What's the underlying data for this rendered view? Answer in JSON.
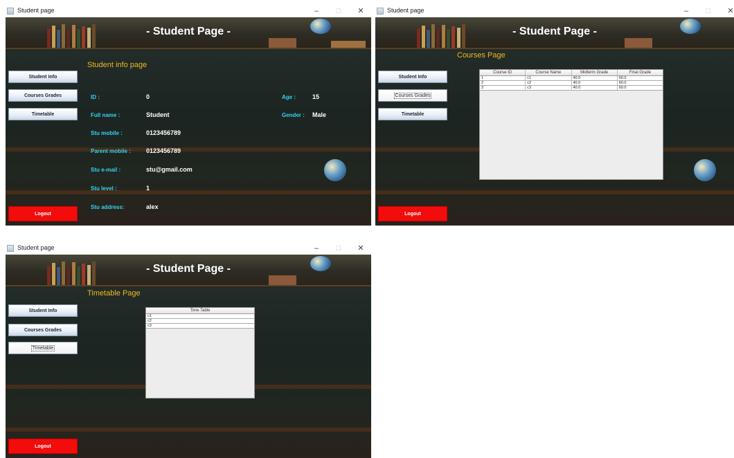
{
  "windows": [
    {
      "title": "Student page",
      "header_title": "- Student Page -",
      "sidebar": {
        "student_info": "Student Info",
        "courses_grades": "Courses Grades",
        "timetable": "Timetable",
        "logout": "Logout",
        "selected": ""
      },
      "page_heading": "Student info page",
      "fields": {
        "id_label": "ID :",
        "id_value": "0",
        "age_label": "Age :",
        "age_value": "15",
        "fullname_label": "Full name :",
        "fullname_value": "Student",
        "gender_label": "Gender :",
        "gender_value": "Male",
        "mobile_label": "Stu mobile :",
        "mobile_value": "0123456789",
        "parent_label": "Parent mobile :",
        "parent_value": "0123456789",
        "email_label": "Stu e-mail :",
        "email_value": "stu@gmail.com",
        "level_label": "Stu level :",
        "level_value": "1",
        "address_label": "Stu address:",
        "address_value": "alex"
      }
    },
    {
      "title": "Student page",
      "header_title": "- Student Page -",
      "sidebar": {
        "student_info": "Student Info",
        "courses_grades": "Courses Grades",
        "timetable": "Timetable",
        "logout": "Logout",
        "selected": "courses_grades"
      },
      "page_heading": "Courses Page",
      "table": {
        "columns": [
          "Course ID",
          "Course Name",
          "Midterm Grade",
          "Final Grade"
        ],
        "rows": [
          [
            "1",
            "c1",
            "40.0",
            "60.0"
          ],
          [
            "2",
            "c2",
            "40.0",
            "60.0"
          ],
          [
            "3",
            "c3",
            "40.0",
            "60.0"
          ]
        ]
      }
    },
    {
      "title": "Student page",
      "header_title": "- Student Page -",
      "sidebar": {
        "student_info": "Student Info",
        "courses_grades": "Courses Grades",
        "timetable": "Timetable",
        "logout": "Logout",
        "selected": "timetable"
      },
      "page_heading": "Timetable Page",
      "table": {
        "columns": [
          "Time Table"
        ],
        "rows": [
          [
            "c1"
          ],
          [
            "c2"
          ],
          [
            "c3"
          ]
        ]
      }
    }
  ],
  "window_controls": {
    "minimize": "–",
    "maximize": "□",
    "close": "✕"
  },
  "colors": {
    "label": "#33d4f0",
    "heading": "#f2b91e",
    "logout": "#f20c0c"
  }
}
